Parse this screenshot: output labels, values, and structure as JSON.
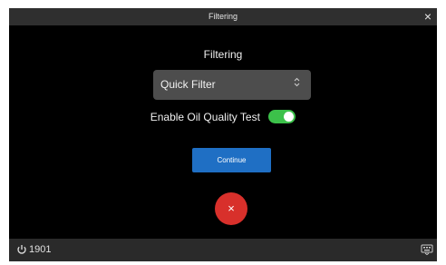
{
  "titlebar": {
    "title": "Filtering",
    "close_glyph": "×"
  },
  "main": {
    "heading": "Filtering",
    "filter_select": {
      "value": "Quick Filter",
      "chevron_glyph": "⌃⌄"
    },
    "oil_quality": {
      "label": "Enable Oil Quality Test",
      "enabled": true
    },
    "continue_label": "Continue",
    "cancel_glyph": "×"
  },
  "bottombar": {
    "power_number": "1901",
    "power_icon": "power-icon",
    "right_icon": "keyboard-icon"
  },
  "colors": {
    "background": "#000000",
    "titlebar": "#2f2f2f",
    "select": "#4d4d4d",
    "toggle_on": "#3cc14a",
    "continue": "#1f6fc4",
    "cancel": "#d8302b"
  }
}
